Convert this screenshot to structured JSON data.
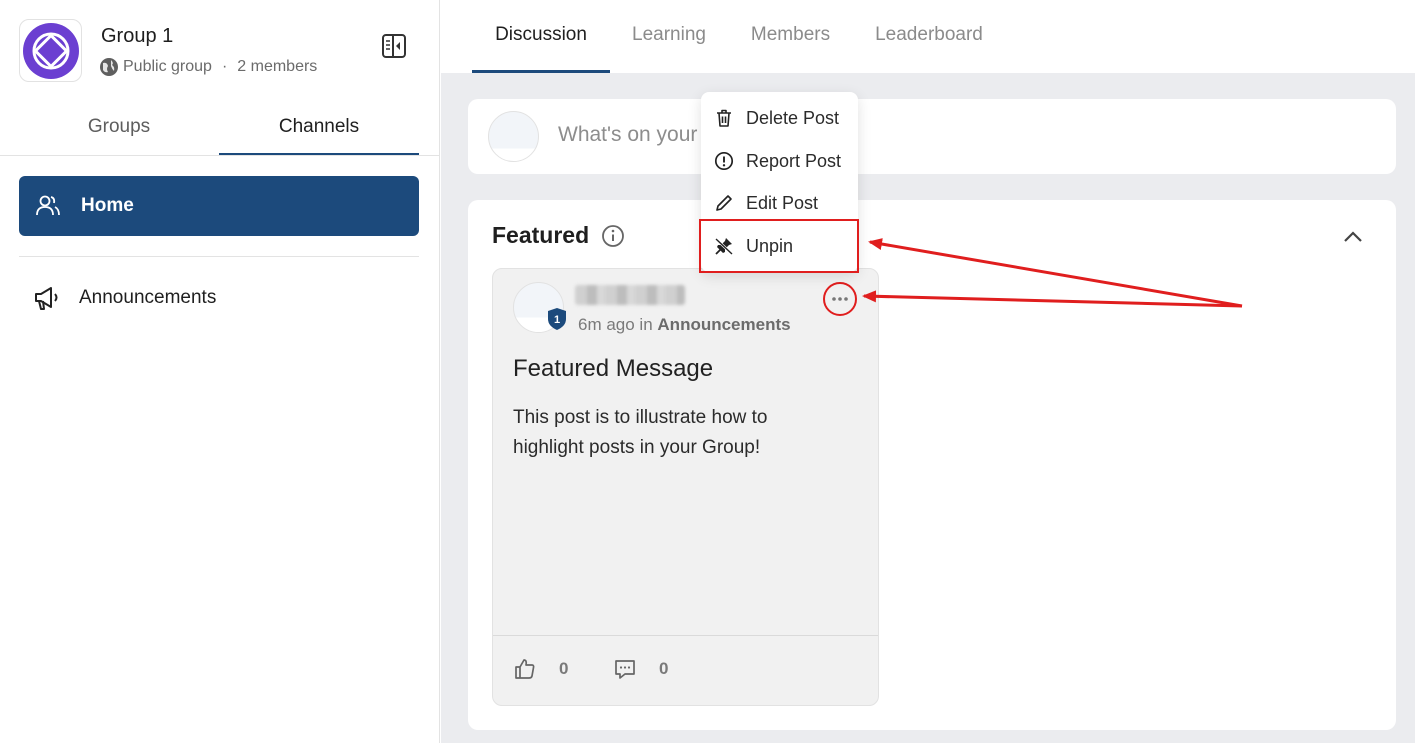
{
  "group": {
    "name": "Group 1",
    "visibility": "Public group",
    "separator": "·",
    "members": "2 members",
    "logo_color": "#6b3fd1"
  },
  "sidebar": {
    "tabs": [
      {
        "label": "Groups",
        "active": false
      },
      {
        "label": "Channels",
        "active": true
      }
    ],
    "items": [
      {
        "label": "Home",
        "icon": "users-icon",
        "active": true
      },
      {
        "label": "Announcements",
        "icon": "megaphone-icon",
        "active": false
      }
    ]
  },
  "main": {
    "tabs": [
      {
        "label": "Discussion",
        "active": true
      },
      {
        "label": "Learning",
        "active": false
      },
      {
        "label": "Members",
        "active": false
      },
      {
        "label": "Leaderboard",
        "active": false
      }
    ],
    "composer": {
      "placeholder": "What's on your"
    },
    "featured": {
      "title": "Featured",
      "post": {
        "badge": "1",
        "time": "6m ago in",
        "channel": "Announcements",
        "heading": "Featured Message",
        "body": "This post is to illustrate how to highlight posts in your Group!",
        "likes": "0",
        "comments": "0"
      }
    }
  },
  "context_menu": {
    "items": [
      {
        "label": "Delete Post",
        "icon": "trash-icon"
      },
      {
        "label": "Report Post",
        "icon": "alert-circle-icon"
      },
      {
        "label": "Edit Post",
        "icon": "pencil-icon"
      },
      {
        "label": "Unpin",
        "icon": "pin-off-icon"
      }
    ]
  },
  "colors": {
    "primary": "#1c4a7c",
    "annotation": "#e01e1e"
  }
}
